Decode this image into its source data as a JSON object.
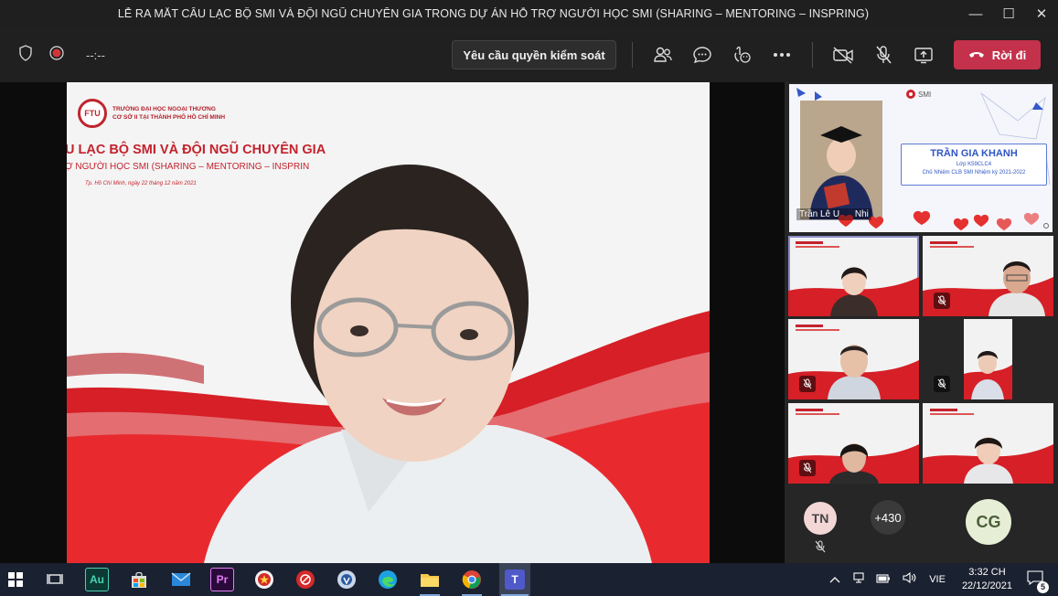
{
  "window": {
    "title": "LỄ RA MẮT CÂU LẠC BỘ SMI VÀ ĐỘI NGŨ CHUYÊN GIA TRONG DỰ ÁN HỖ TRỢ NGƯỜI HỌC SMI (SHARING – MENTORING – INSPRING)",
    "minimize": "—",
    "maximize": "☐",
    "close": "✕"
  },
  "toolbar": {
    "timer": "--:--",
    "request_control": "Yêu cầu quyền kiểm soát",
    "leave": "Rời đi",
    "colors": {
      "leave_bg": "#c4314b",
      "bar_bg": "#202020"
    }
  },
  "slide": {
    "school_line1": "TRƯỜNG ĐẠI HỌC NGOẠI THƯƠNG",
    "school_line2": "CƠ SỞ II TẠI THÀNH PHỐ HỒ CHÍ MINH",
    "heading": "U LẠC BỘ SMI VÀ ĐỘI NGŨ CHUYÊN GIA",
    "subheading": "Ợ NGƯỜI HỌC SMI (SHARING – MENTORING – INSPRIN",
    "date": "Tp. Hồ Chí Minh, ngày 22 tháng 12 năm 2021"
  },
  "shared_card": {
    "brand": "SMI",
    "name": "TRẦN GIA KHANH",
    "class_line": "Lớp K59CLC4",
    "role_line": "Chủ Nhiệm CLB SMI Nhiệm kỳ 2021-2022",
    "presenter": "Trần Lê U",
    "presenter_suffix": "Nhi"
  },
  "participants": {
    "tn_initials": "TN",
    "overflow": "+430",
    "cg_initials": "CG"
  },
  "taskbar": {
    "apps": [
      "Au",
      "Pr",
      "T"
    ],
    "language": "VIE",
    "time": "3:32 CH",
    "date": "22/12/2021",
    "notifications": "5"
  }
}
